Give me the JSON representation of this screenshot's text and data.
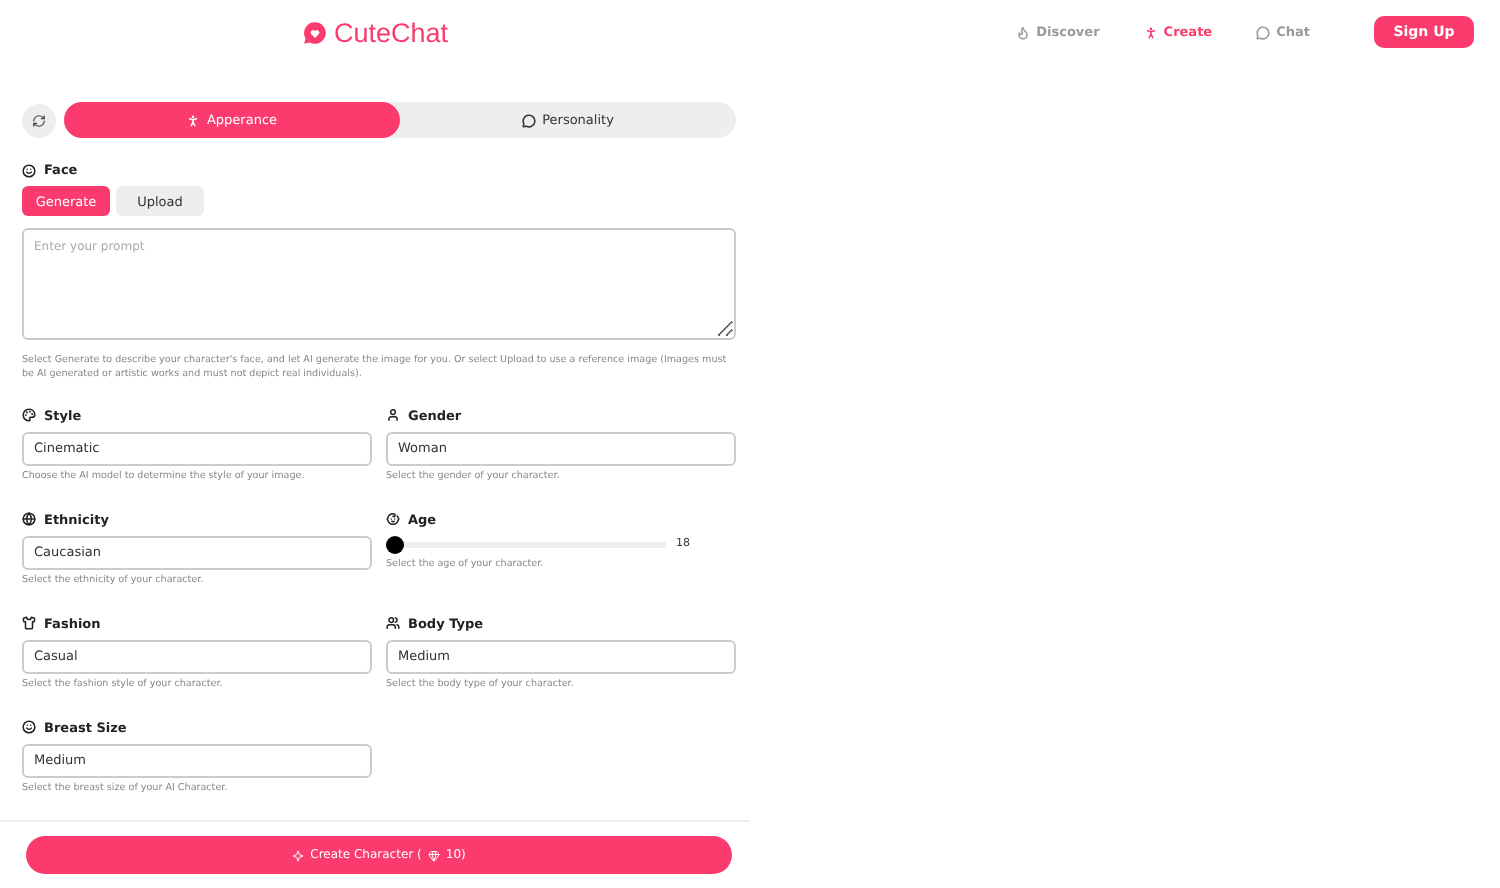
{
  "header": {
    "logo": "CuteChat",
    "nav": [
      {
        "label": "Discover",
        "selected": false
      },
      {
        "label": "Create",
        "selected": true
      },
      {
        "label": "Chat",
        "selected": false
      }
    ],
    "signup": "Sign Up"
  },
  "tabs": [
    {
      "label": "Apperance",
      "selected": true
    },
    {
      "label": "Personality",
      "selected": false
    }
  ],
  "face": {
    "label": "Face",
    "modes": [
      {
        "label": "Generate",
        "selected": true
      },
      {
        "label": "Upload",
        "selected": false
      }
    ],
    "placeholder": "Enter your prompt",
    "help": "Select Generate to describe your character's face, and let AI generate the image for you. Or select Upload to use a reference image (Images must be AI generated or artistic works and must not depict real individuals)."
  },
  "fields": [
    {
      "kind": "select",
      "label": "Style",
      "value": "Cinematic",
      "help": "Choose the AI model to determine the style of your image."
    },
    {
      "kind": "select",
      "label": "Gender",
      "value": "Woman",
      "help": "Select the gender of your character."
    },
    {
      "kind": "select",
      "label": "Ethnicity",
      "value": "Caucasian",
      "help": "Select the ethnicity of your character."
    },
    {
      "kind": "slider",
      "label": "Age",
      "level": 0,
      "reading": "18",
      "help": "Select the age of your character."
    },
    {
      "kind": "select",
      "label": "Fashion",
      "value": "Casual",
      "help": "Select the fashion style of your character."
    },
    {
      "kind": "select",
      "label": "Body Type",
      "value": "Medium",
      "help": "Select the body type of your character."
    },
    {
      "kind": "select",
      "label": "Breast Size",
      "value": "Medium",
      "help": "Select the breast size of your AI Character."
    }
  ],
  "create": {
    "label": "Create Character",
    "cost_open": "(",
    "cost": "10)"
  }
}
